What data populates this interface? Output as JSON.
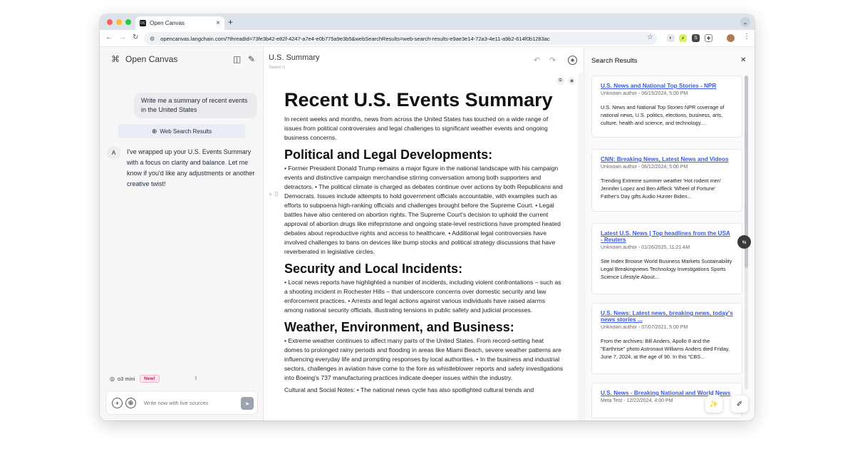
{
  "browser": {
    "tab_title": "Open Canvas",
    "tab_favicon": "OC",
    "new_tab": "+",
    "url": "opencanvas.langchain.com/?threadId=73fe3b42-e82f-4247-a7e4-e0b775a9e3b5&webSearchResults=web-search-results-e9ae3e14-72a3-4e11-a9b2-614f0b1283ac",
    "colors": {
      "close": "#ff5f57",
      "minimize": "#febc2e",
      "maximize": "#28c840"
    }
  },
  "sidebar": {
    "brand": "Open Canvas",
    "user_message": "Write me a summary of recent events in the United States",
    "web_results_button": "Web Search Results",
    "assistant_avatar": "A",
    "assistant_message": "I've wrapped up your U.S. Events Summary with a focus on clarity and balance. Let me know if you'd like any adjustments or another creative twist!",
    "model": "o3 mini",
    "model_badge": "New!",
    "composer_placeholder": "Write now with live sources"
  },
  "editor": {
    "title": "U.S. Summary",
    "status": "Saved",
    "doc": {
      "h1": "Recent U.S. Events Summary",
      "intro": "In recent weeks and months, news from across the United States has touched on a wide range of issues from political controversies and legal challenges to significant weather events and ongoing business concerns.",
      "s1_title": "Political and Legal Developments:",
      "s1_body": "• Former President Donald Trump remains a major figure in the national landscape with his campaign events and distinctive campaign merchandise stirring conversation among both supporters and detractors. • The political climate is charged as debates continue over actions by both Republicans and Democrats. Issues include attempts to hold government officials accountable, with examples such as efforts to subpoena high-ranking officials and challenges brought before the Supreme Court. • Legal battles have also centered on abortion rights. The Supreme Court's decision to uphold the current approval of abortion drugs like mifepristone and ongoing state-level restrictions have prompted heated debates about reproductive rights and access to healthcare. • Additional legal controversies have involved challenges to bans on devices like bump stocks and political strategy discussions that have reverberated in legislative circles.",
      "s2_title": "Security and Local Incidents:",
      "s2_body": "• Local news reports have highlighted a number of incidents, including violent confrontations – such as a shooting incident in Rochester Hills – that underscore concerns over domestic security and law enforcement practices. • Arrests and legal actions against various individuals have raised alarms among national security officials, illustrating tensions in public safety and judicial processes.",
      "s3_title": "Weather, Environment, and Business:",
      "s3_body": "• Extreme weather continues to affect many parts of the United States. From record-setting heat domes to prolonged rainy periods and flooding in areas like Miami Beach, severe weather patterns are influencing everyday life and prompting responses by local authorities. • In the business and industrial sectors, challenges in aviation have come to the fore as whistleblower reports and safety investigations into Boeing's 737 manufacturing practices indicate deeper issues within the industry.",
      "s4_body": "Cultural and Social Notes: • The national news cycle has also spotlighted cultural trends and"
    }
  },
  "results": {
    "header": "Search Results",
    "items": [
      {
        "title": "U.S. News and National Top Stories - NPR",
        "meta": "Unknown author - 06/15/2024, 5:00 PM",
        "snippet": "U.S. News and National Top Stories NPR coverage of national news, U.S. politics, elections, business, arts, culture, health and science, and technology...."
      },
      {
        "title": "CNN: Breaking News, Latest News and Videos",
        "meta": "Unknown author - 06/12/2024, 5:00 PM",
        "snippet": "Trending Extreme summer weather 'Hot rodent men' Jennifer Lopez and Ben Affleck 'Wheel of Fortune' Father's Day gifts Audio Hunter Biden..."
      },
      {
        "title": "Latest U.S. News | Top headlines from the USA - Reuters",
        "meta": "Unknown author - 01/26/2025, 11:21 AM",
        "snippet": "Site Index Browse World Business Markets Sustainability Legal Breakingviews Technology Investigations Sports Science Lifestyle About..."
      },
      {
        "title": "U.S. News: Latest news, breaking news, today's news stories ...",
        "meta": "Unknown author - 07/07/2021, 5:00 PM",
        "snippet": "From the archives: Bill Anders, Apollo 8 and the \"Earthrise\" photo Astronaut Williams Anders died Friday, June 7, 2024, at the age of 90. In this \"CBS..."
      },
      {
        "title": "U.S. News - Breaking National and World News",
        "meta": "Meta Test - 12/22/2024, 4:00 PM",
        "snippet": ""
      }
    ]
  },
  "colors": {
    "accent": "#3b5bdb",
    "badge": "#c2185b"
  }
}
